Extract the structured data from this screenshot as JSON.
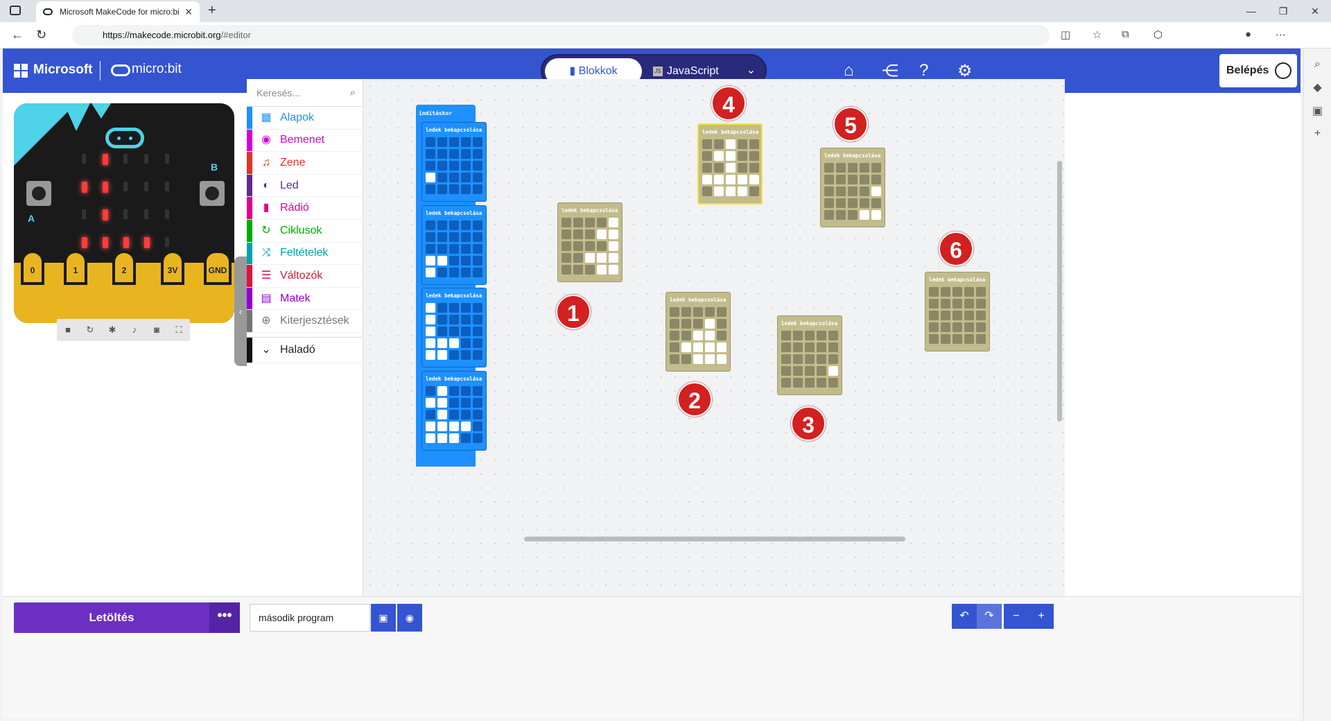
{
  "browser": {
    "tab_title": "Microsoft MakeCode for micro:bi",
    "url_host": "https://makecode.microbit.org",
    "url_path": "/#editor"
  },
  "header": {
    "microsoft": "Microsoft",
    "microbit": "micro:bit",
    "blocks_label": "Blokkok",
    "js_label": "JavaScript",
    "login_label": "Belépés"
  },
  "simulator": {
    "pins": [
      "0",
      "1",
      "2",
      "3V",
      "GND"
    ],
    "button_a": "A",
    "button_b": "B",
    "leds": [
      [
        0,
        1,
        0,
        0,
        0
      ],
      [
        1,
        1,
        0,
        0,
        0
      ],
      [
        0,
        1,
        0,
        0,
        0
      ],
      [
        1,
        1,
        1,
        1,
        0
      ],
      [
        0,
        1,
        0,
        0,
        0
      ]
    ]
  },
  "toolbox": {
    "search_placeholder": "Keresés...",
    "categories": [
      {
        "label": "Alapok",
        "color": "#1e90ff"
      },
      {
        "label": "Bemenet",
        "color": "#d400d4"
      },
      {
        "label": "Zene",
        "color": "#e63022"
      },
      {
        "label": "Led",
        "color": "#5c2d91"
      },
      {
        "label": "Rádió",
        "color": "#e3008c"
      },
      {
        "label": "Ciklusok",
        "color": "#00aa00"
      },
      {
        "label": "Feltételek",
        "color": "#00a4a6"
      },
      {
        "label": "Változók",
        "color": "#dc143c"
      },
      {
        "label": "Matek",
        "color": "#9400d3"
      },
      {
        "label": "Kiterjesztések",
        "color": "#757575"
      }
    ],
    "advanced": "Haladó"
  },
  "workspace": {
    "start_block": "indításkor",
    "led_block_label": "ledek bekapcsolása",
    "stacked_blocks": [
      [
        [
          0,
          0,
          0,
          0,
          0
        ],
        [
          0,
          0,
          0,
          0,
          0
        ],
        [
          0,
          0,
          0,
          0,
          0
        ],
        [
          1,
          0,
          0,
          0,
          0
        ],
        [
          0,
          0,
          0,
          0,
          0
        ]
      ],
      [
        [
          0,
          0,
          0,
          0,
          0
        ],
        [
          0,
          0,
          0,
          0,
          0
        ],
        [
          0,
          0,
          0,
          0,
          0
        ],
        [
          1,
          1,
          0,
          0,
          0
        ],
        [
          1,
          0,
          0,
          0,
          0
        ]
      ],
      [
        [
          1,
          0,
          0,
          0,
          0
        ],
        [
          1,
          0,
          0,
          0,
          0
        ],
        [
          1,
          0,
          0,
          0,
          0
        ],
        [
          1,
          1,
          1,
          0,
          0
        ],
        [
          1,
          1,
          0,
          0,
          0
        ]
      ],
      [
        [
          0,
          1,
          0,
          0,
          0
        ],
        [
          1,
          1,
          0,
          0,
          0
        ],
        [
          0,
          1,
          0,
          0,
          0
        ],
        [
          1,
          1,
          1,
          1,
          0
        ],
        [
          1,
          1,
          1,
          0,
          0
        ]
      ]
    ],
    "loose_blocks": [
      {
        "number": "1",
        "leds": [
          [
            0,
            0,
            0,
            0,
            1
          ],
          [
            0,
            0,
            0,
            1,
            1
          ],
          [
            0,
            0,
            0,
            0,
            1
          ],
          [
            0,
            0,
            1,
            1,
            1
          ],
          [
            0,
            0,
            0,
            1,
            1
          ]
        ]
      },
      {
        "number": "2",
        "leds": [
          [
            0,
            0,
            0,
            0,
            0
          ],
          [
            0,
            0,
            0,
            1,
            0
          ],
          [
            0,
            0,
            1,
            1,
            0
          ],
          [
            0,
            1,
            1,
            1,
            1
          ],
          [
            0,
            0,
            1,
            1,
            1
          ]
        ]
      },
      {
        "number": "3",
        "leds": [
          [
            0,
            0,
            0,
            0,
            0
          ],
          [
            0,
            0,
            0,
            0,
            0
          ],
          [
            0,
            0,
            0,
            0,
            0
          ],
          [
            0,
            0,
            0,
            0,
            1
          ],
          [
            0,
            0,
            0,
            0,
            0
          ]
        ]
      },
      {
        "number": "4",
        "leds": [
          [
            0,
            0,
            1,
            0,
            0
          ],
          [
            0,
            1,
            1,
            0,
            0
          ],
          [
            0,
            0,
            1,
            0,
            0
          ],
          [
            1,
            1,
            1,
            1,
            1
          ],
          [
            0,
            1,
            1,
            1,
            0
          ]
        ]
      },
      {
        "number": "5",
        "leds": [
          [
            0,
            0,
            0,
            0,
            0
          ],
          [
            0,
            0,
            0,
            0,
            0
          ],
          [
            0,
            0,
            0,
            0,
            1
          ],
          [
            0,
            0,
            0,
            0,
            0
          ],
          [
            0,
            0,
            0,
            1,
            1
          ]
        ]
      },
      {
        "number": "6",
        "leds": [
          [
            0,
            0,
            0,
            0,
            0
          ],
          [
            0,
            0,
            0,
            0,
            0
          ],
          [
            0,
            0,
            0,
            0,
            0
          ],
          [
            0,
            0,
            0,
            0,
            0
          ],
          [
            0,
            0,
            0,
            0,
            0
          ]
        ]
      }
    ]
  },
  "footer": {
    "download": "Letöltés",
    "project_name": "második program"
  }
}
